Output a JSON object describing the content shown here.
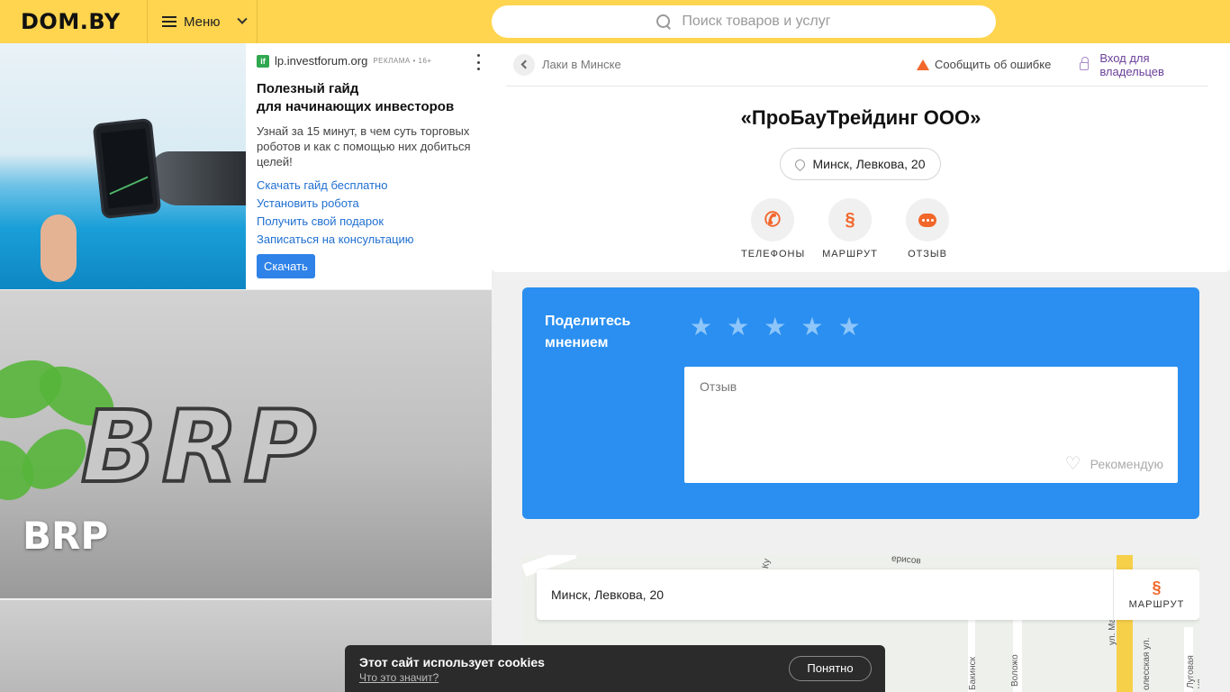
{
  "header": {
    "logo": "DOM.BY",
    "menu_label": "Меню",
    "search_placeholder": "Поиск товаров и услуг"
  },
  "ad": {
    "source": "lp.investforum.org",
    "label": "РЕКЛАМА • 16+",
    "title_line1": "Полезный гайд",
    "title_line2": "для начинающих инвесторов",
    "description": "Узнай за 15 минут, в чем суть торговых роботов и как с помощью них добиться целей!",
    "links": [
      "Скачать гайд бесплатно",
      "Установить робота",
      "Получить свой подарок",
      "Записаться на консультацию"
    ],
    "button": "Скачать"
  },
  "brand": {
    "name": "BRP"
  },
  "company": {
    "breadcrumb": "Лаки в Минске",
    "report": "Сообщить об ошибке",
    "owner_login": "Вход для владельцев",
    "title": "«ПроБауТрейдинг ООО»",
    "address": "Минск, Левкова, 20",
    "actions": [
      {
        "label": "ТЕЛЕФОНЫ",
        "icon": "phone-icon"
      },
      {
        "label": "МАРШРУТ",
        "icon": "route-icon"
      },
      {
        "label": "ОТЗЫВ",
        "icon": "comment-icon"
      }
    ]
  },
  "review": {
    "title": "Поделитесь мнением",
    "stars": 5,
    "placeholder": "Отзыв",
    "recommend": "Рекомендую"
  },
  "map": {
    "address": "Минск, Левкова, 20",
    "route_label": "МАРШРУТ",
    "street_labels": [
      "ул. Маяк",
      "Воложо",
      "Бакинск",
      "Луговая ул.",
      "олесская ул.",
      "Ку",
      "ерисов"
    ]
  },
  "cookie": {
    "title": "Этот сайт использует cookies",
    "link": "Что это значит?",
    "button": "Понятно"
  },
  "colors": {
    "header": "#ffd54f",
    "accent_orange": "#f2662a",
    "review_blue": "#2a8ff0",
    "link_blue": "#1f6fd1",
    "owner_purple": "#6a3f98"
  }
}
